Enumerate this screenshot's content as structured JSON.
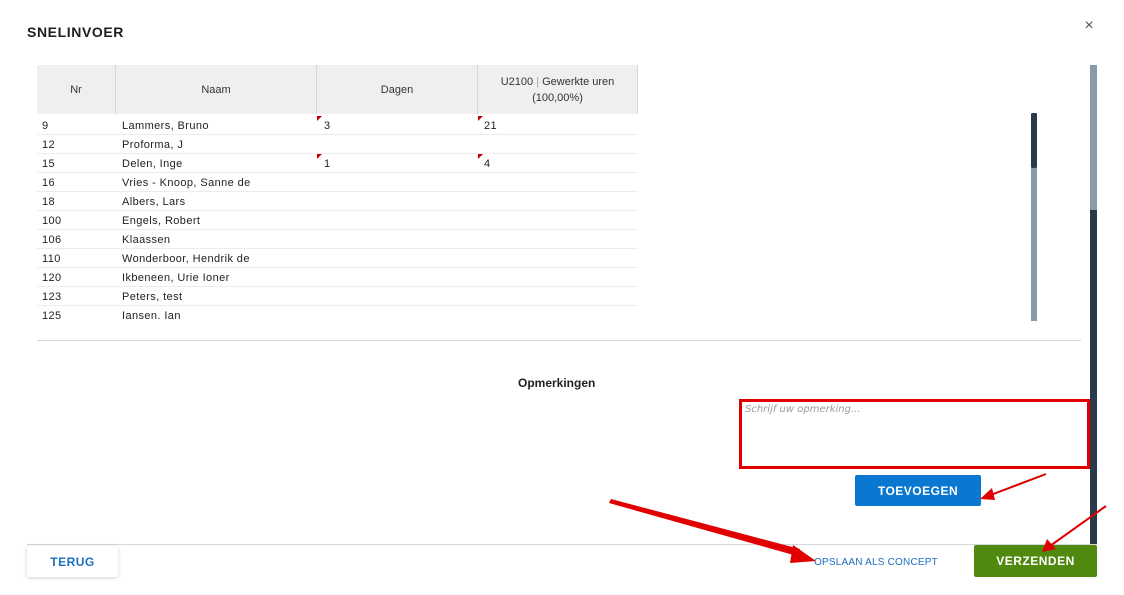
{
  "dialog": {
    "title": "SNELINVOER",
    "close_symbol": "×"
  },
  "table": {
    "headers": {
      "nr": "Nr",
      "naam": "Naam",
      "dagen": "Dagen",
      "uren_code": "U2100",
      "uren_sep": "|",
      "uren_label": "Gewerkte uren",
      "uren_pct": "(100,00%)"
    },
    "rows": [
      {
        "nr": "9",
        "naam": "Lammers, Bruno",
        "dagen": "3",
        "uren": "21",
        "flag": true
      },
      {
        "nr": "12",
        "naam": "Proforma, J",
        "dagen": "",
        "uren": "",
        "flag": false
      },
      {
        "nr": "15",
        "naam": "Delen, Inge",
        "dagen": "1",
        "uren": "4",
        "flag": true
      },
      {
        "nr": "16",
        "naam": "Vries - Knoop, Sanne de",
        "dagen": "",
        "uren": "",
        "flag": false
      },
      {
        "nr": "18",
        "naam": "Albers, Lars",
        "dagen": "",
        "uren": "",
        "flag": false
      },
      {
        "nr": "100",
        "naam": "Engels, Robert",
        "dagen": "",
        "uren": "",
        "flag": false
      },
      {
        "nr": "106",
        "naam": "Klaassen",
        "dagen": "",
        "uren": "",
        "flag": false
      },
      {
        "nr": "110",
        "naam": "Wonderboor, Hendrik de",
        "dagen": "",
        "uren": "",
        "flag": false
      },
      {
        "nr": "120",
        "naam": "Ikbeneen, Urie Ioner",
        "dagen": "",
        "uren": "",
        "flag": false
      },
      {
        "nr": "123",
        "naam": "Peters, test",
        "dagen": "",
        "uren": "",
        "flag": false
      },
      {
        "nr": "125",
        "naam": "Iansen. Ian",
        "dagen": "",
        "uren": "",
        "flag": false
      }
    ]
  },
  "remarks": {
    "label": "Opmerkingen",
    "placeholder": "Schrijf uw opmerking...",
    "value": ""
  },
  "buttons": {
    "add": "TOEVOEGEN",
    "back": "TERUG",
    "save_concept": "OPSLAAN ALS CONCEPT",
    "send": "VERZENDEN"
  },
  "colors": {
    "annotation_red": "#e00000",
    "primary_blue": "#0a78d1",
    "send_green": "#4f8a0e",
    "flag_red": "#c00000"
  }
}
